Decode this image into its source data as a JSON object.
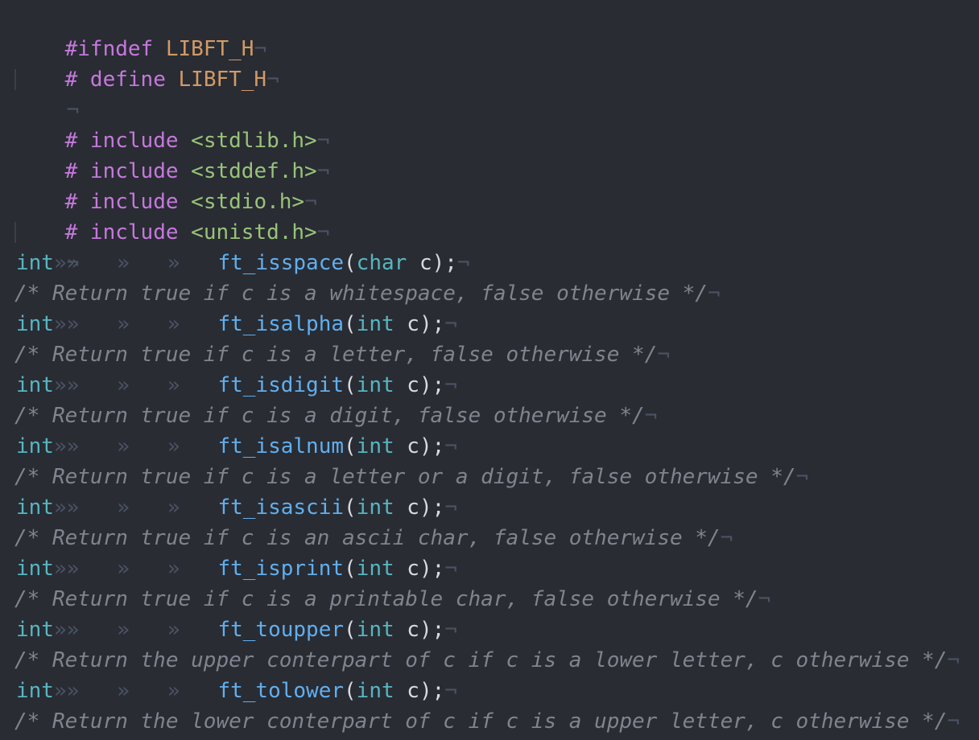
{
  "editor": {
    "language": "C",
    "whitespace_markers": {
      "eol": "¬",
      "tab": "»"
    },
    "colors": {
      "background": "#292c33",
      "preprocessor": "#c678dd",
      "macro": "#d19a66",
      "string": "#98c379",
      "type": "#56b6c2",
      "function": "#61afef",
      "comment": "#7f848e",
      "text": "#d7dae0"
    },
    "lines": {
      "ifndef": {
        "directive": "#ifndef",
        "macro": "LIBFT_H"
      },
      "define": {
        "directive": "# define",
        "macro": "LIBFT_H"
      },
      "includes": [
        {
          "directive": "# include",
          "header": "<stdlib.h>"
        },
        {
          "directive": "# include",
          "header": "<stddef.h>"
        },
        {
          "directive": "# include",
          "header": "<stdio.h>"
        },
        {
          "directive": "# include",
          "header": "<unistd.h>"
        }
      ],
      "prototypes": [
        {
          "ret": "int",
          "name": "ft_isspace",
          "param_type": "char",
          "param_name": "c",
          "comment": "/* Return true if c is a whitespace, false otherwise */"
        },
        {
          "ret": "int",
          "name": "ft_isalpha",
          "param_type": "int",
          "param_name": "c",
          "comment": "/* Return true if c is a letter, false otherwise */"
        },
        {
          "ret": "int",
          "name": "ft_isdigit",
          "param_type": "int",
          "param_name": "c",
          "comment": "/* Return true if c is a digit, false otherwise */"
        },
        {
          "ret": "int",
          "name": "ft_isalnum",
          "param_type": "int",
          "param_name": "c",
          "comment": "/* Return true if c is a letter or a digit, false otherwise */"
        },
        {
          "ret": "int",
          "name": "ft_isascii",
          "param_type": "int",
          "param_name": "c",
          "comment": "/* Return true if c is an ascii char, false otherwise */"
        },
        {
          "ret": "int",
          "name": "ft_isprint",
          "param_type": "int",
          "param_name": "c",
          "comment": "/* Return true if c is a printable char, false otherwise */"
        },
        {
          "ret": "int",
          "name": "ft_toupper",
          "param_type": "int",
          "param_name": "c",
          "comment": "/* Return the upper conterpart of c if c is a lower letter, c otherwise */"
        },
        {
          "ret": "int",
          "name": "ft_tolower",
          "param_type": "int",
          "param_name": "c",
          "comment": "/* Return the lower conterpart of c if c is a upper letter, c otherwise */"
        }
      ]
    }
  }
}
